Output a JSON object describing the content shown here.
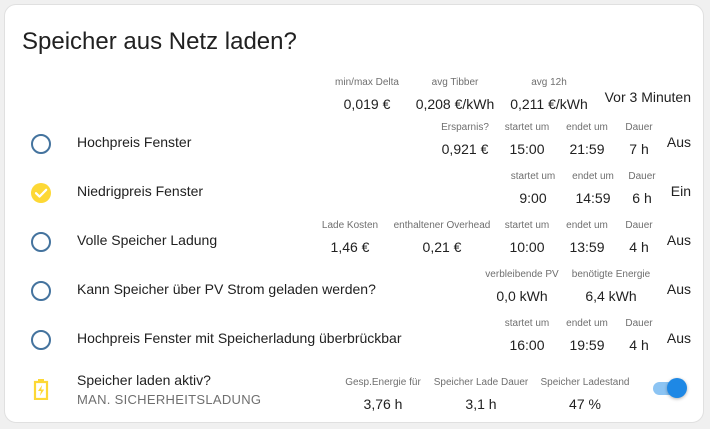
{
  "card": {
    "title": "Speicher aus Netz laden?"
  },
  "header_row": {
    "attributes": [
      {
        "label": "min/max Delta",
        "value": "0,019 €"
      },
      {
        "label": "avg Tibber",
        "value": "0,208 €/kWh"
      },
      {
        "label": "avg 12h",
        "value": "0,211 €/kWh"
      }
    ],
    "state": "Vor 3 Minuten"
  },
  "rows": [
    {
      "name": "Hochpreis Fenster",
      "icon": "radio-unchecked-icon",
      "attributes": [
        {
          "label": "Ersparnis?",
          "value": "0,921 €"
        },
        {
          "label": "startet um",
          "value": "15:00"
        },
        {
          "label": "endet um",
          "value": "21:59"
        },
        {
          "label": "Dauer",
          "value": "7 h"
        }
      ],
      "state": "Aus"
    },
    {
      "name": "Niedrigpreis Fenster",
      "icon": "check-circle-icon",
      "attributes": [
        {
          "label": "startet um",
          "value": "9:00"
        },
        {
          "label": "endet um",
          "value": "14:59"
        },
        {
          "label": "Dauer",
          "value": "6 h"
        }
      ],
      "state": "Ein"
    },
    {
      "name": "Volle Speicher Ladung",
      "icon": "radio-unchecked-icon",
      "attributes": [
        {
          "label": "Lade Kosten",
          "value": "1,46 €"
        },
        {
          "label": "enthaltener Overhead",
          "value": "0,21 €"
        },
        {
          "label": "startet um",
          "value": "10:00"
        },
        {
          "label": "endet um",
          "value": "13:59"
        },
        {
          "label": "Dauer",
          "value": "4 h"
        }
      ],
      "state": "Aus"
    },
    {
      "name": "Kann Speicher über PV Strom geladen werden?",
      "icon": "radio-unchecked-icon",
      "attributes": [
        {
          "label": "verbleibende PV",
          "value": "0,0 kWh"
        },
        {
          "label": "benötigte Energie",
          "value": "6,4 kWh"
        }
      ],
      "state": "Aus"
    },
    {
      "name": "Hochpreis Fenster mit Speicherladung überbrückbar",
      "icon": "radio-unchecked-icon",
      "attributes": [
        {
          "label": "startet um",
          "value": "16:00"
        },
        {
          "label": "endet um",
          "value": "19:59"
        },
        {
          "label": "Dauer",
          "value": "4 h"
        }
      ],
      "state": "Aus"
    }
  ],
  "toggle_row": {
    "name": "Speicher laden aktiv?",
    "secondary": "MAN. SICHERHEITSLADUNG",
    "icon": "battery-charging-icon",
    "attributes": [
      {
        "label": "Gesp.Energie für",
        "value": "3,76 h"
      },
      {
        "label": "Speicher Lade Dauer",
        "value": "3,1 h"
      },
      {
        "label": "Speicher Ladestand",
        "value": "47 %"
      }
    ],
    "toggle_on": true
  },
  "colors": {
    "radio": "#44739e",
    "active": "#fdd835",
    "toggle_knob": "#1e88e5",
    "toggle_track": "#8cc4f3"
  }
}
